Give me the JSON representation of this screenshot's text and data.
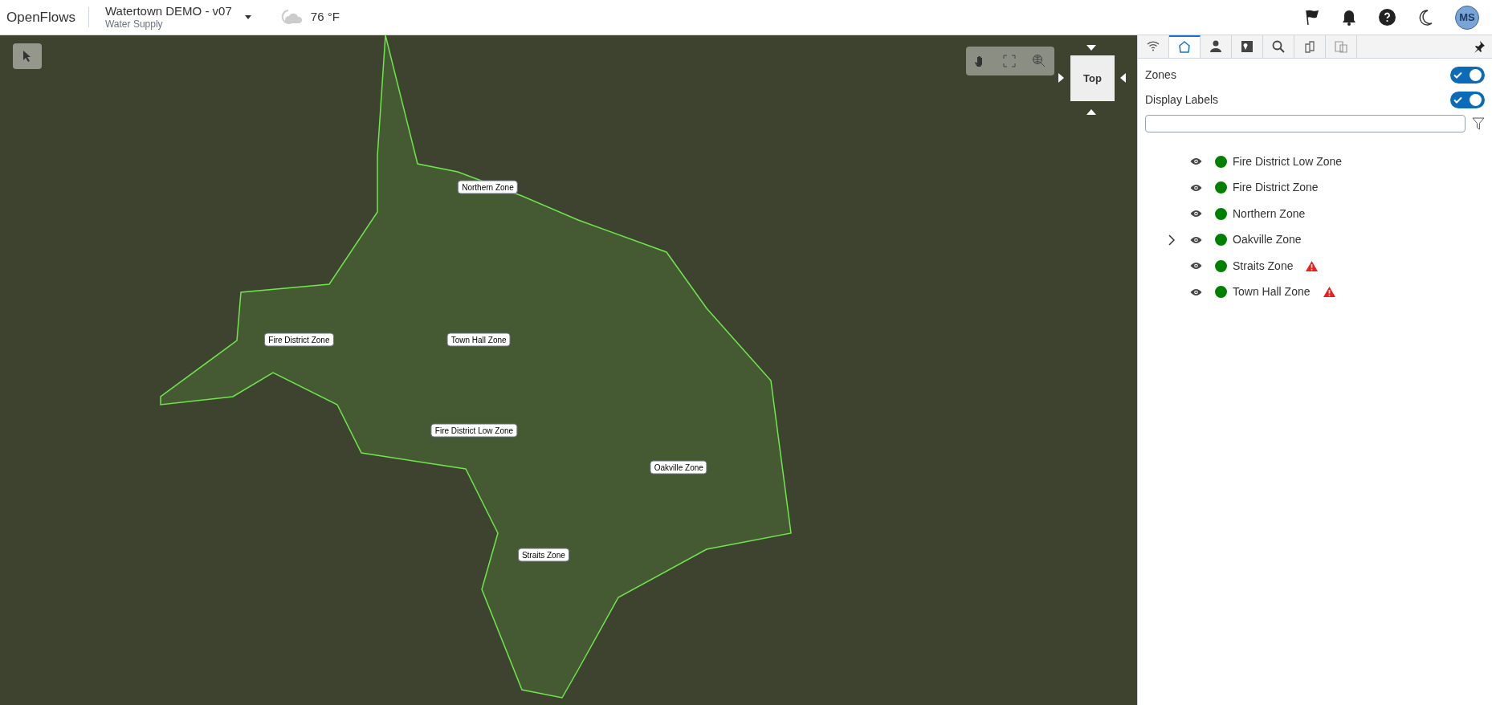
{
  "header": {
    "app_name": "OpenFlows",
    "project": "Watertown DEMO - v07",
    "subtitle": "Water Supply",
    "temperature": "76 °F",
    "avatar": "MS"
  },
  "map": {
    "zone_labels": [
      {
        "text": "Northern Zone"
      },
      {
        "text": "Fire District Zone"
      },
      {
        "text": "Town Hall Zone"
      },
      {
        "text": "Fire District Low Zone"
      },
      {
        "text": "Oakville Zone"
      },
      {
        "text": "Straits Zone"
      }
    ],
    "view_cube": "Top"
  },
  "panel": {
    "tabs": [
      {
        "kind": "signal",
        "selected": false
      },
      {
        "kind": "zones",
        "selected": true
      },
      {
        "kind": "person",
        "selected": false
      },
      {
        "kind": "map",
        "selected": false
      },
      {
        "kind": "search",
        "selected": false
      },
      {
        "kind": "tools",
        "selected": false
      },
      {
        "kind": "report",
        "selected": false
      }
    ],
    "toggles": [
      {
        "label": "Zones",
        "on": true
      },
      {
        "label": "Display Labels",
        "on": true
      }
    ],
    "zones": [
      {
        "name": "Fire District Low Zone",
        "color": "#008000",
        "expandable": false,
        "warning": false
      },
      {
        "name": "Fire District Zone",
        "color": "#008000",
        "expandable": false,
        "warning": false
      },
      {
        "name": "Northern Zone",
        "color": "#008000",
        "expandable": false,
        "warning": false
      },
      {
        "name": "Oakville Zone",
        "color": "#008000",
        "expandable": true,
        "warning": false
      },
      {
        "name": "Straits Zone",
        "color": "#008000",
        "expandable": false,
        "warning": true
      },
      {
        "name": "Town Hall Zone",
        "color": "#008000",
        "expandable": false,
        "warning": true
      }
    ]
  }
}
